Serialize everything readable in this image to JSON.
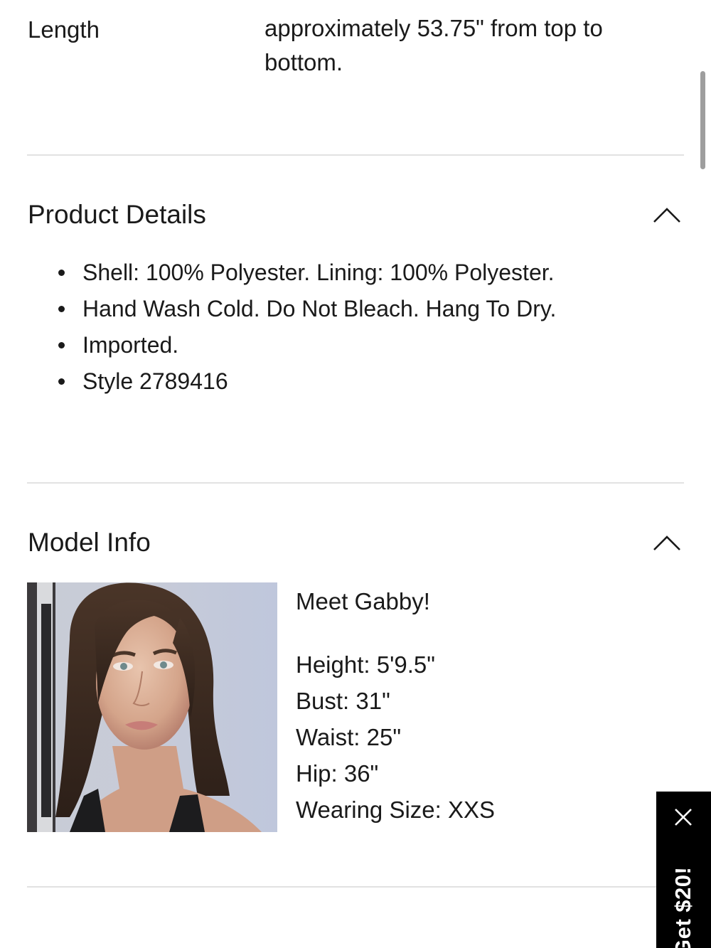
{
  "length_row": {
    "label": "Length",
    "value": "approximately 53.75\" from top to bottom."
  },
  "product_details": {
    "title": "Product Details",
    "toggle_icon": "chevron-up-icon",
    "items": [
      "Shell: 100% Polyester. Lining: 100% Polyester.",
      "Hand Wash Cold. Do Not Bleach. Hang To Dry.",
      "Imported.",
      "Style 2789416"
    ]
  },
  "model_info": {
    "title": "Model Info",
    "toggle_icon": "chevron-up-icon",
    "intro": "Meet Gabby!",
    "stats": [
      "Height: 5'9.5\"",
      "Bust: 31\"",
      "Waist: 25\"",
      "Hip: 36\"",
      "Wearing Size: XXS"
    ]
  },
  "promo": {
    "label": "Get $20!",
    "close_icon": "close-icon",
    "background": "#000000",
    "text_color": "#ffffff"
  },
  "colors": {
    "text": "#1a1a1a",
    "divider": "#e2e2e2",
    "scrollbar": "#9e9e9e"
  }
}
